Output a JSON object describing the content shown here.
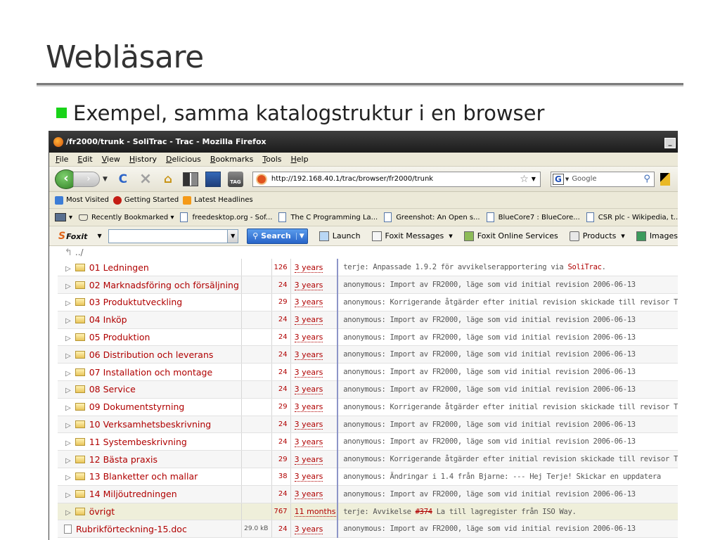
{
  "slide": {
    "title": "Webläsare",
    "bullet": "Exempel, samma katalogstruktur i en browser"
  },
  "browser": {
    "window_title": "/fr2000/trunk - SoliTrac - Trac - Mozilla Firefox",
    "minimize_label": "_",
    "menu": [
      "File",
      "Edit",
      "View",
      "History",
      "Delicious",
      "Bookmarks",
      "Tools",
      "Help"
    ],
    "url": "http://192.168.40.1/trac/browser/fr2000/trunk",
    "search_engine": "Google",
    "search_placeholder": "Google",
    "tag_label": "TAG",
    "bookmarks_row1": [
      "Most Visited",
      "Getting Started",
      "Latest Headlines"
    ],
    "bookmarks_row2": [
      "Recently Bookmarked",
      "freedesktop.org - Sof...",
      "The C Programming La...",
      "Greenshot: An Open s...",
      "BlueCore7 : BlueCore...",
      "CSR plc - Wikipedia, t..."
    ],
    "foxit": {
      "logo": "Foxit",
      "search_label": "Search",
      "items": [
        "Launch",
        "Foxit Messages",
        "Foxit Online Services",
        "Products",
        "Images"
      ]
    }
  },
  "listing": {
    "parent": "../",
    "rows": [
      {
        "name": "01 Ledningen",
        "size": "",
        "rev": "126",
        "age": "3 years",
        "log_pre": "terje: Anpassade 1.9.2 för avvikelserapportering via ",
        "log_link": "SoliTrac",
        "log_post": "."
      },
      {
        "name": "02 Marknadsföring och försäljning",
        "size": "",
        "rev": "24",
        "age": "3 years",
        "log_pre": "anonymous: Import av FR2000, läge som vid initial revision 2006-06-13",
        "log_link": "",
        "log_post": ""
      },
      {
        "name": "03 Produktutveckling",
        "size": "",
        "rev": "29",
        "age": "3 years",
        "log_pre": "anonymous: Korrigerande åtgärder efter initial revision skickade till revisor T",
        "log_link": "",
        "log_post": ""
      },
      {
        "name": "04 Inköp",
        "size": "",
        "rev": "24",
        "age": "3 years",
        "log_pre": "anonymous: Import av FR2000, läge som vid initial revision 2006-06-13",
        "log_link": "",
        "log_post": ""
      },
      {
        "name": "05 Produktion",
        "size": "",
        "rev": "24",
        "age": "3 years",
        "log_pre": "anonymous: Import av FR2000, läge som vid initial revision 2006-06-13",
        "log_link": "",
        "log_post": ""
      },
      {
        "name": "06 Distribution och leverans",
        "size": "",
        "rev": "24",
        "age": "3 years",
        "log_pre": "anonymous: Import av FR2000, läge som vid initial revision 2006-06-13",
        "log_link": "",
        "log_post": ""
      },
      {
        "name": "07 Installation och montage",
        "size": "",
        "rev": "24",
        "age": "3 years",
        "log_pre": "anonymous: Import av FR2000, läge som vid initial revision 2006-06-13",
        "log_link": "",
        "log_post": ""
      },
      {
        "name": "08 Service",
        "size": "",
        "rev": "24",
        "age": "3 years",
        "log_pre": "anonymous: Import av FR2000, läge som vid initial revision 2006-06-13",
        "log_link": "",
        "log_post": ""
      },
      {
        "name": "09 Dokumentstyrning",
        "size": "",
        "rev": "29",
        "age": "3 years",
        "log_pre": "anonymous: Korrigerande åtgärder efter initial revision skickade till revisor T",
        "log_link": "",
        "log_post": ""
      },
      {
        "name": "10 Verksamhetsbeskrivning",
        "size": "",
        "rev": "24",
        "age": "3 years",
        "log_pre": "anonymous: Import av FR2000, läge som vid initial revision 2006-06-13",
        "log_link": "",
        "log_post": ""
      },
      {
        "name": "11 Systembeskrivning",
        "size": "",
        "rev": "24",
        "age": "3 years",
        "log_pre": "anonymous: Import av FR2000, läge som vid initial revision 2006-06-13",
        "log_link": "",
        "log_post": ""
      },
      {
        "name": "12 Bästa praxis",
        "size": "",
        "rev": "29",
        "age": "3 years",
        "log_pre": "anonymous: Korrigerande åtgärder efter initial revision skickade till revisor T",
        "log_link": "",
        "log_post": ""
      },
      {
        "name": "13 Blanketter och mallar",
        "size": "",
        "rev": "38",
        "age": "3 years",
        "log_pre": "anonymous: Ändringar i 1.4 från Bjarne: --- Hej Terje! Skickar en uppdatera",
        "log_link": "",
        "log_post": ""
      },
      {
        "name": "14 Miljöutredningen",
        "size": "",
        "rev": "24",
        "age": "3 years",
        "log_pre": "anonymous: Import av FR2000, läge som vid initial revision 2006-06-13",
        "log_link": "",
        "log_post": ""
      },
      {
        "name": "övrigt",
        "size": "",
        "rev": "767",
        "age": "11 months",
        "log_pre": "terje: Avvikelse ",
        "log_link": "#374",
        "log_post": " La till lagregister från ISO Way."
      },
      {
        "name": "Rubrikförteckning-15.doc",
        "size": "29.0 kB",
        "rev": "24",
        "age": "3 years",
        "log_pre": "anonymous: Import av FR2000, läge som vid initial revision 2006-06-13",
        "log_link": "",
        "log_post": ""
      }
    ]
  }
}
